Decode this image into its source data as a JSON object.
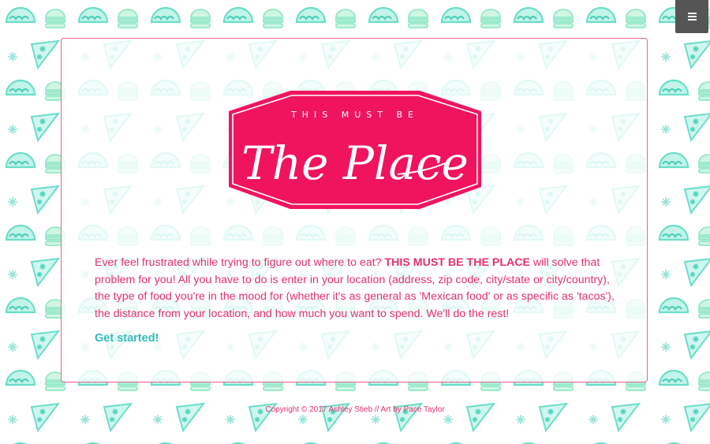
{
  "menu": {
    "icon": "hamburger-icon"
  },
  "logo": {
    "top_text": "THIS MUST BE",
    "main_text": "The Place",
    "color": "#f0145f"
  },
  "intro": {
    "text_before": "Ever feel frustrated while trying to figure out where to eat? ",
    "highlight": "THIS MUST BE THE PLACE",
    "text_after": " will solve that problem for you! All you have to do is enter in your location (address, zip code, city/state or city/country), the type of food you're in the mood for (whether it's as general as 'Mexican food' or as specific as 'tacos'), the distance from your location, and how much you want to spend. We'll do the rest!"
  },
  "cta": {
    "label": "Get started!"
  },
  "footer": {
    "text": "Copyright © 2017 Ashley Stieb // Art by Pace Taylor"
  },
  "colors": {
    "accent_pink": "#e8306a",
    "accent_teal": "#33bcb8",
    "menu_bg": "#555555"
  },
  "background": {
    "pattern_icons": [
      "taco-icon",
      "pizza-slice-icon",
      "burger-icon",
      "sparkle-icon"
    ]
  }
}
